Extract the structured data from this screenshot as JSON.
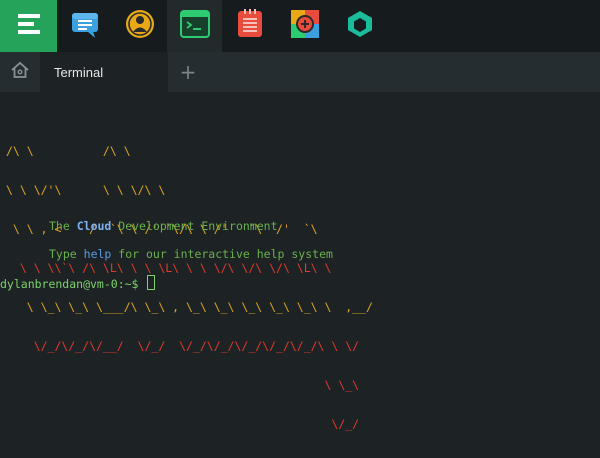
{
  "toolbar": {
    "apps": [
      {
        "icon": "menu-icon"
      },
      {
        "icon": "chat-icon"
      },
      {
        "icon": "user-guide-icon"
      },
      {
        "icon": "terminal-icon"
      },
      {
        "icon": "notes-icon"
      },
      {
        "icon": "add-app-icon"
      },
      {
        "icon": "hexagon-icon"
      }
    ]
  },
  "tabs": {
    "home_icon": "home-icon",
    "active_tab_label": "Terminal",
    "add_label": "+"
  },
  "terminal": {
    "banner_ascii": [
      "/\\ \\          /\\ \\",
      "\\ \\ \\/'\\      \\ \\ \\/\\ \\",
      " \\ \\ , <    /  `\\ \\ /' `\\/\\ \\ /'   `\\  /'  `\\",
      "  \\ \\ \\\\`\\ /\\ \\L\\ \\ \\ \\L\\ \\ \\ \\/\\ \\/\\ \\/\\ \\L\\ \\",
      "   \\ \\_\\ \\_\\ \\___/\\ \\_\\ , \\_\\ \\_\\ \\_\\ \\_\\ \\_\\ \\  ,__/",
      "    \\/_/\\/_/\\/__/  \\/_/  \\/_/\\/_/\\/_/\\/_/\\/_/\\ \\ \\/",
      "                                              \\ \\_\\",
      "                                               \\/_/"
    ],
    "tagline_prefix": "The",
    "tagline_highlight": "Cloud",
    "tagline_suffix": "Development Environment",
    "help_prefix": "Type",
    "help_command": "help",
    "help_suffix": "for our interactive help system",
    "prompt": "dylanbrendan@vm-0:~$"
  },
  "colors": {
    "menu_green": "#25a35a",
    "banner_yellow": "#e0a521",
    "banner_red": "#e23a2c",
    "text_green": "#6ab04c",
    "help_blue": "#5b9be0",
    "prompt_green": "#7dd26a"
  }
}
